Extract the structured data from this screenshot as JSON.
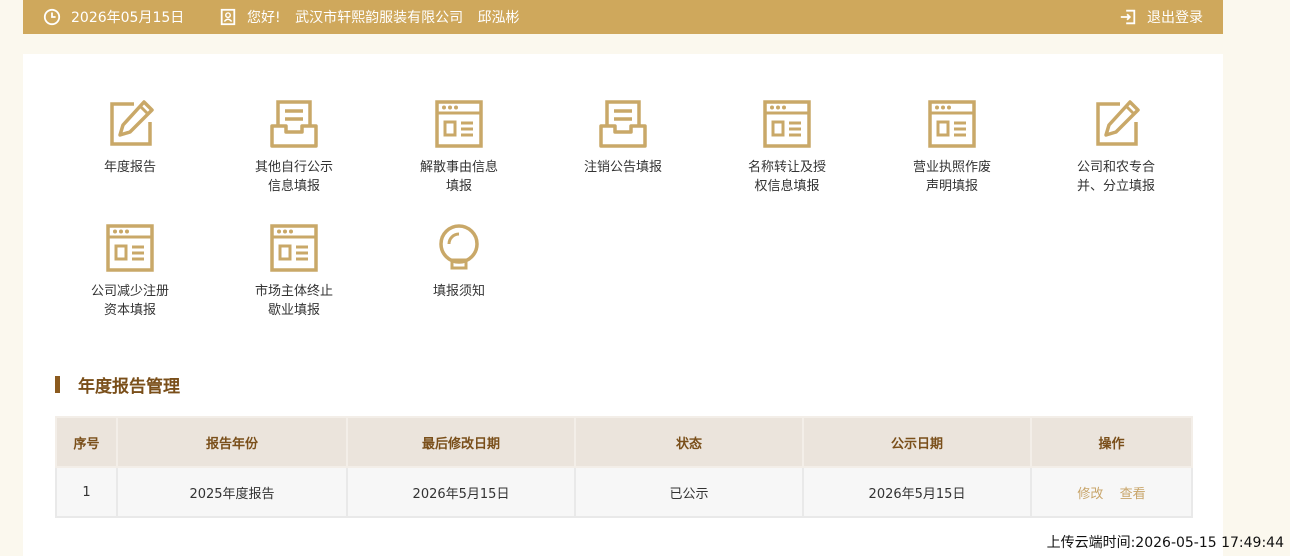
{
  "topbar": {
    "date": "2026年05月15日",
    "greeting": "您好!",
    "company": "武汉市轩熙韵服装有限公司",
    "user": "邱泓彬",
    "logout_label": "退出登录",
    "icons": {
      "date": "clock-icon",
      "user": "user-card-icon",
      "logout": "logout-icon"
    }
  },
  "tiles": [
    {
      "icon": "edit-icon",
      "lines": [
        "年度报告"
      ]
    },
    {
      "icon": "inbox-tray-icon",
      "lines": [
        "其他自行公示",
        "信息填报"
      ]
    },
    {
      "icon": "browser-form-icon",
      "lines": [
        "解散事由信息",
        "填报"
      ]
    },
    {
      "icon": "inbox-tray-icon",
      "lines": [
        "注销公告填报"
      ]
    },
    {
      "icon": "browser-form-icon",
      "lines": [
        "名称转让及授",
        "权信息填报"
      ]
    },
    {
      "icon": "browser-form-icon",
      "lines": [
        "营业执照作废",
        "声明填报"
      ]
    },
    {
      "icon": "edit-icon",
      "lines": [
        "公司和农专合",
        "并、分立填报"
      ]
    },
    {
      "icon": "browser-form-icon",
      "lines": [
        "公司减少注册",
        "资本填报"
      ]
    },
    {
      "icon": "browser-form-icon",
      "lines": [
        "市场主体终止",
        "歇业填报"
      ]
    },
    {
      "icon": "lightbulb-icon",
      "lines": [
        "填报须知"
      ]
    }
  ],
  "section": {
    "title": "年度报告管理"
  },
  "table": {
    "headers": [
      "序号",
      "报告年份",
      "最后修改日期",
      "状态",
      "公示日期",
      "操作"
    ],
    "rows": [
      {
        "index": "1",
        "year": "2025年度报告",
        "modified": "2026年5月15日",
        "status": "已公示",
        "publish_date": "2026年5月15日",
        "actions": [
          "修改",
          "查看"
        ]
      }
    ]
  },
  "footer": {
    "upload_time": "上传云端时间:2026-05-15 17:49:44"
  },
  "colors": {
    "accent": "#cfa85c",
    "icon_gold": "#c9a868",
    "title_brown": "#7a4f1a",
    "page_bg": "#fbf8ee"
  }
}
